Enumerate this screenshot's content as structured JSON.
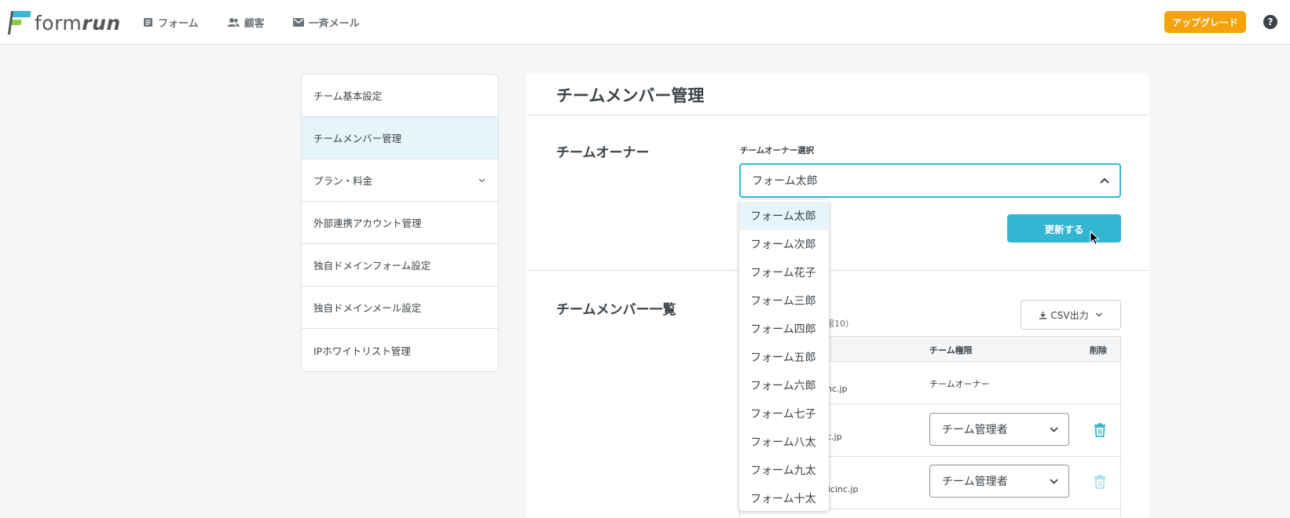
{
  "header": {
    "logo_text_light": "form",
    "logo_text_bold": "run",
    "nav": [
      {
        "label": "フォーム",
        "icon": "form-icon"
      },
      {
        "label": "顧客",
        "icon": "users-icon"
      },
      {
        "label": "一斉メール",
        "icon": "mail-icon"
      }
    ],
    "upgrade_label": "アップグレード",
    "help_label": "?"
  },
  "sidebar": {
    "items": [
      {
        "label": "チーム基本設定"
      },
      {
        "label": "チームメンバー管理",
        "active": true
      },
      {
        "label": "プラン・料金",
        "expandable": true
      },
      {
        "label": "外部連携アカウント管理"
      },
      {
        "label": "独自ドメインフォーム設定"
      },
      {
        "label": "独自ドメインメール設定"
      },
      {
        "label": "IPホワイトリスト管理"
      }
    ]
  },
  "main": {
    "title": "チームメンバー管理",
    "owner_section": {
      "title": "チームオーナー",
      "field_label": "チームオーナー選択",
      "selected": "フォーム太郎",
      "update_label": "更新する"
    },
    "members_section": {
      "title": "チームメンバー一覧",
      "count_text": "上限10）",
      "csv_label": "CSV出力",
      "table": {
        "headers": {
          "role": "チーム権限",
          "delete": "削除"
        },
        "rows": [
          {
            "email_visible": "nc.jp",
            "role_text": "チームオーナー"
          },
          {
            "email_visible": "c.jp",
            "role_select": "チーム管理者"
          },
          {
            "email_visible": "sicinc.jp",
            "role_select": "チーム管理者"
          }
        ]
      }
    }
  },
  "dropdown": {
    "options": [
      "フォーム太郎",
      "フォーム次郎",
      "フォーム花子",
      "フォーム三郎",
      "フォーム四郎",
      "フォーム五郎",
      "フォーム六郎",
      "フォーム七子",
      "フォーム八太",
      "フォーム九太",
      "フォーム十太"
    ],
    "selected_index": 0
  },
  "colors": {
    "accent": "#34b6d3",
    "upgrade": "#f5a30b",
    "active_bg": "#e6f5fa"
  }
}
